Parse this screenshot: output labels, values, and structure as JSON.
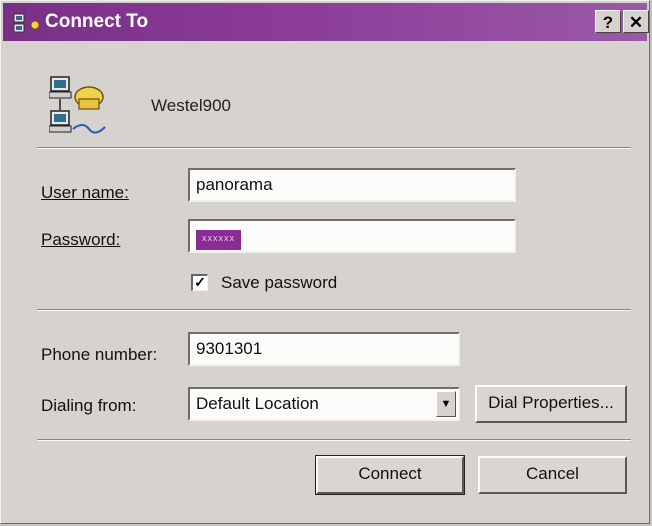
{
  "window": {
    "title": "Connect To",
    "help_button": "?",
    "close_button": "✕"
  },
  "connection": {
    "name": "Westel900"
  },
  "form": {
    "user_name_label": "User name:",
    "user_name_value": "panorama",
    "password_label": "Password:",
    "password_mask": "xxxxxx",
    "save_password_label": "Save password",
    "save_password_checked": true,
    "phone_number_label": "Phone number:",
    "phone_number_value": "9301301",
    "dialing_from_label": "Dialing from:",
    "dialing_from_value": "Default Location"
  },
  "buttons": {
    "dial_properties": "Dial Properties...",
    "connect": "Connect",
    "cancel": "Cancel"
  },
  "colors": {
    "titlebar": "#7a2f86",
    "password_highlight": "#8a2d93"
  }
}
